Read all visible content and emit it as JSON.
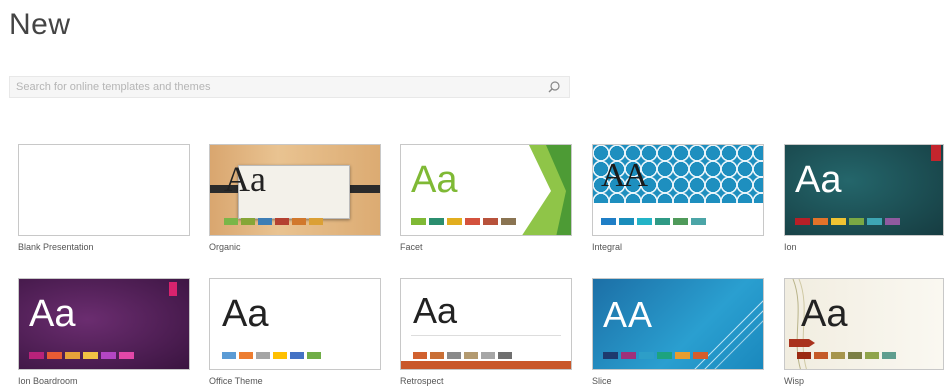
{
  "page": {
    "title": "New"
  },
  "search": {
    "placeholder": "Search for online templates and themes"
  },
  "templates": [
    {
      "name": "Blank Presentation"
    },
    {
      "name": "Organic",
      "sample": "Aa",
      "swatches": [
        "#7ab648",
        "#86a637",
        "#3d7eb5",
        "#b44131",
        "#d1782c",
        "#dba035"
      ]
    },
    {
      "name": "Facet",
      "sample": "Aa",
      "swatches": [
        "#7fb935",
        "#2b8e6f",
        "#e2ae1f",
        "#d4523d",
        "#b8523b",
        "#8a7452"
      ]
    },
    {
      "name": "Integral",
      "sample": "AA",
      "swatches": [
        "#1f7ec6",
        "#1a8dbb",
        "#23b4c7",
        "#2f9a85",
        "#4f9a5a",
        "#4ba5a7"
      ]
    },
    {
      "name": "Ion",
      "sample": "Aa",
      "swatches": [
        "#b71f27",
        "#e3732a",
        "#f0c332",
        "#7aa844",
        "#3ea6b4",
        "#8f5aa0"
      ]
    },
    {
      "name": "Ion Boardroom",
      "sample": "Aa",
      "swatches": [
        "#b8227a",
        "#e85b34",
        "#e8a33a",
        "#f3c244",
        "#b346c3",
        "#e247a8"
      ]
    },
    {
      "name": "Office Theme",
      "sample": "Aa",
      "swatches": [
        "#5b9bd5",
        "#ed7d31",
        "#a5a5a5",
        "#ffc000",
        "#4472c4",
        "#70ad47"
      ]
    },
    {
      "name": "Retrospect",
      "sample": "Aa",
      "swatches": [
        "#d1612e",
        "#c96f36",
        "#8a8a8a",
        "#b39a70",
        "#a6a6a6",
        "#6f6f6f"
      ]
    },
    {
      "name": "Slice",
      "sample": "AA",
      "swatches": [
        "#1e3a6e",
        "#a0307a",
        "#2d9ec8",
        "#1da37e",
        "#e79d2f",
        "#d65d2b"
      ]
    },
    {
      "name": "Wisp",
      "sample": "Aa",
      "swatches": [
        "#9b2a12",
        "#c55a28",
        "#a6954c",
        "#7b7f45",
        "#8fa44b",
        "#5f9e8f"
      ]
    }
  ]
}
